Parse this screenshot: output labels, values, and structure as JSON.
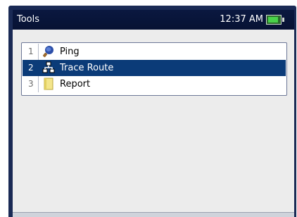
{
  "window": {
    "title": "Tools",
    "time": "12:37 AM"
  },
  "status": {
    "battery_icon": "battery-icon",
    "battery_level": 0.9
  },
  "tools": [
    {
      "number": "1",
      "label": "Ping",
      "icon": "ping-paddle-icon",
      "selected": false
    },
    {
      "number": "2",
      "label": "Trace Route",
      "icon": "trace-route-icon",
      "selected": true
    },
    {
      "number": "3",
      "label": "Report",
      "icon": "report-icon",
      "selected": false
    }
  ],
  "colors": {
    "titlebar": "#0a1840",
    "selection": "#0b3b78",
    "background": "#ececec"
  }
}
